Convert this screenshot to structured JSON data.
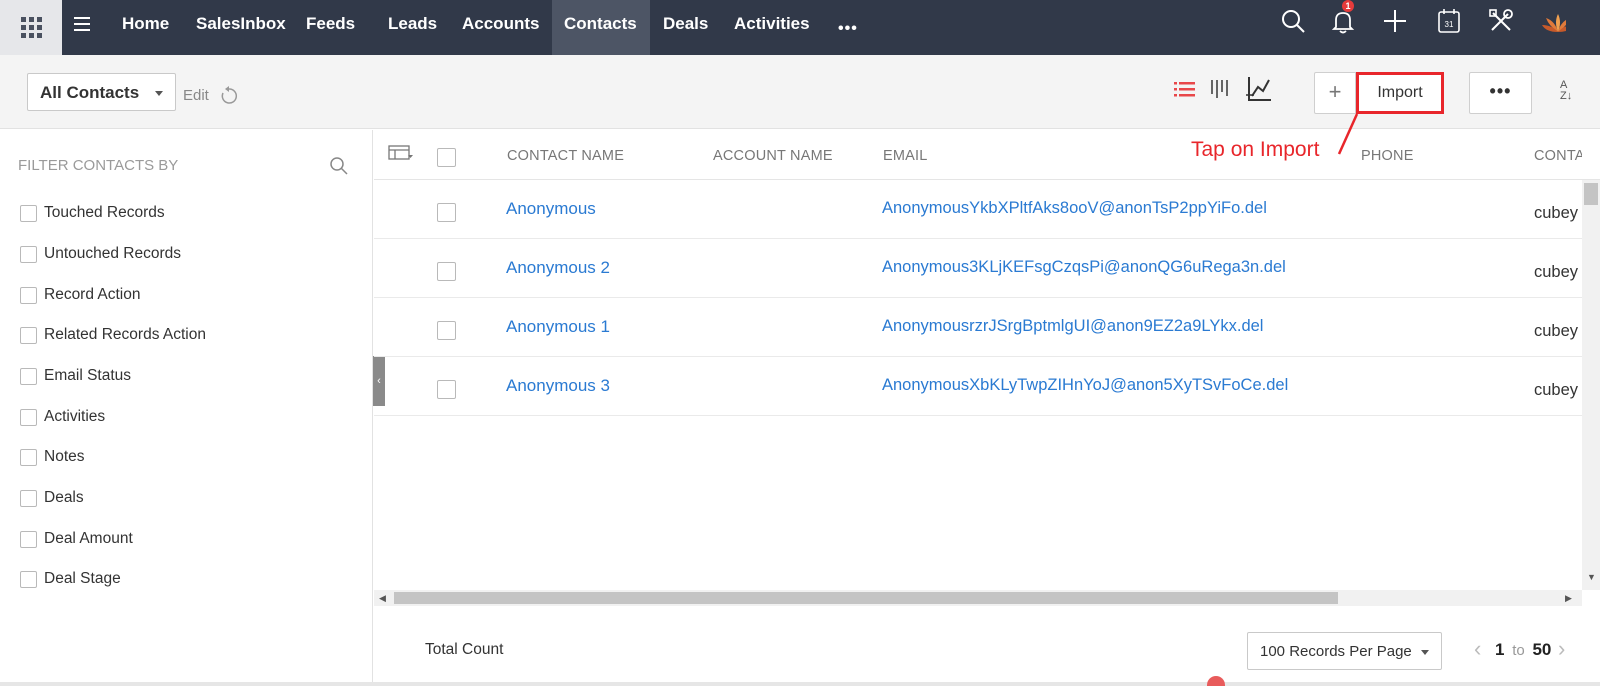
{
  "nav": {
    "items": [
      {
        "label": "Home",
        "active": false
      },
      {
        "label": "SalesInbox",
        "active": false
      },
      {
        "label": "Feeds",
        "active": false
      },
      {
        "label": "Leads",
        "active": false
      },
      {
        "label": "Accounts",
        "active": false
      },
      {
        "label": "Contacts",
        "active": true
      },
      {
        "label": "Deals",
        "active": false
      },
      {
        "label": "Activities",
        "active": false
      }
    ],
    "more": "•••",
    "notification_count": "1",
    "calendar_day": "31",
    "accent_bg": "#313949"
  },
  "toolbar": {
    "view": "All Contacts",
    "edit": "Edit",
    "plus": "+",
    "import": "Import",
    "more": "•••",
    "sort_top": "A",
    "sort_bottom": "Z↓"
  },
  "sidebar": {
    "title": "FILTER CONTACTS BY",
    "filters": [
      "Touched Records",
      "Untouched Records",
      "Record Action",
      "Related Records Action",
      "Email Status",
      "Activities",
      "Notes",
      "Deals",
      "Deal Amount",
      "Deal Stage"
    ],
    "collapse": "‹"
  },
  "table": {
    "columns": [
      "CONTACT NAME",
      "ACCOUNT NAME",
      "EMAIL",
      "PHONE",
      "CONTACT"
    ],
    "rows": [
      {
        "name": "Anonymous",
        "account": "",
        "email": "AnonymousYkbXPltfAks8ooV@anonTsP2ppYiFo.del",
        "phone": "",
        "owner": "cubey"
      },
      {
        "name": "Anonymous 2",
        "account": "",
        "email": "Anonymous3KLjKEFsgCzqsPi@anonQG6uRega3n.del",
        "phone": "",
        "owner": "cubey"
      },
      {
        "name": "Anonymous 1",
        "account": "",
        "email": "AnonymousrzrJSrgBptmlgUI@anon9EZ2a9LYkx.del",
        "phone": "",
        "owner": "cubey"
      },
      {
        "name": "Anonymous 3",
        "account": "",
        "email": "AnonymousXbKLyTwpZIHnYoJ@anon5XyTSvFoCe.del",
        "phone": "",
        "owner": "cubey"
      }
    ]
  },
  "annotation": "Tap on Import",
  "footer": {
    "total_count": "Total Count",
    "per_page": "100 Records Per Page",
    "page_from": "1",
    "page_to_word": "to",
    "page_to": "50"
  }
}
